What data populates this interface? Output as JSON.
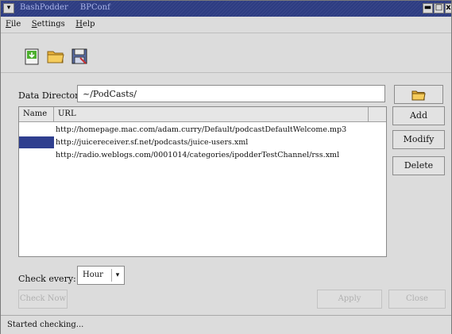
{
  "window": {
    "title": "BashPodder",
    "subtitle": "BPConf"
  },
  "titlebar": {
    "menu_glyph": "▾",
    "minimize_glyph": "▬",
    "maximize_glyph": "□",
    "close_glyph": "x"
  },
  "menubar": {
    "items": [
      {
        "underline": "F",
        "rest": "ile"
      },
      {
        "underline": "S",
        "rest": "ettings"
      },
      {
        "underline": "H",
        "rest": "elp"
      }
    ]
  },
  "toolbar": {
    "icons": [
      "new-file-icon",
      "open-folder-icon",
      "save-icon"
    ]
  },
  "data_directory": {
    "label": "Data Directory:",
    "value": "~/PodCasts/",
    "browse_icon": "folder-icon"
  },
  "table": {
    "columns": [
      "Name",
      "URL"
    ],
    "rows": [
      {
        "name": "",
        "url": "http://homepage.mac.com/adam.curry/Default/podcastDefaultWelcome.mp3",
        "selected": false
      },
      {
        "name": "",
        "url": "http://juicereceiver.sf.net/podcasts/juice-users.xml",
        "selected": true
      },
      {
        "name": "",
        "url": "http://radio.weblogs.com/0001014/categories/ipodderTestChannel/rss.xml",
        "selected": false
      }
    ]
  },
  "buttons": {
    "add": "Add",
    "modify": "Modify",
    "delete": "Delete",
    "check_now": "Check Now",
    "apply": "Apply",
    "close": "Close"
  },
  "check_every": {
    "label": "Check every:",
    "selected": "Hour",
    "arrow": "▾"
  },
  "status": {
    "text": "Started checking..."
  },
  "colors": {
    "titlebar": "#2d3c82",
    "selection": "#2f3f8f"
  }
}
